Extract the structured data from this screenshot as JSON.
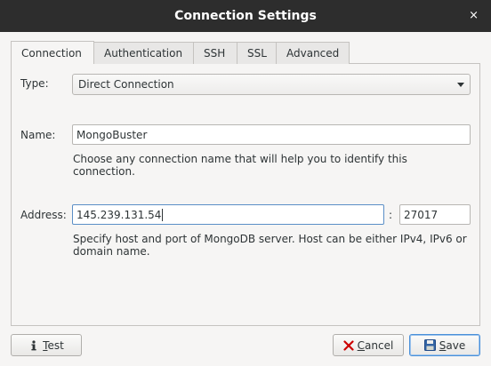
{
  "window": {
    "title": "Connection Settings",
    "close_glyph": "×"
  },
  "tabs": [
    {
      "label": "Connection",
      "active": true
    },
    {
      "label": "Authentication",
      "active": false
    },
    {
      "label": "SSH",
      "active": false
    },
    {
      "label": "SSL",
      "active": false
    },
    {
      "label": "Advanced",
      "active": false
    }
  ],
  "form": {
    "type_label": "Type:",
    "type_value": "Direct Connection",
    "name_label": "Name:",
    "name_value": "MongoBuster",
    "name_help_line1": "Choose any connection name that will help you to identify this",
    "name_help_line2": "connection.",
    "address_label": "Address:",
    "address_value": "145.239.131.54",
    "port_separator": ":",
    "port_value": "27017",
    "address_help_line1": "Specify host and port of MongoDB server. Host can be either IPv4, IPv6 or",
    "address_help_line2": "domain name."
  },
  "buttons": {
    "test_mnemonic": "T",
    "test_rest": "est",
    "cancel_mnemonic": "C",
    "cancel_rest": "ancel",
    "save_mnemonic": "S",
    "save_rest": "ave"
  },
  "icons": {
    "test": "info-icon",
    "cancel": "cancel-x-icon",
    "save": "floppy-disk-icon",
    "close": "close-icon",
    "dropdown": "chevron-down-icon"
  },
  "colors": {
    "titlebar": "#2d2d2d",
    "focus_border": "#5b8fc7",
    "cancel_icon": "#cc0000",
    "save_icon": "#3465a4"
  }
}
